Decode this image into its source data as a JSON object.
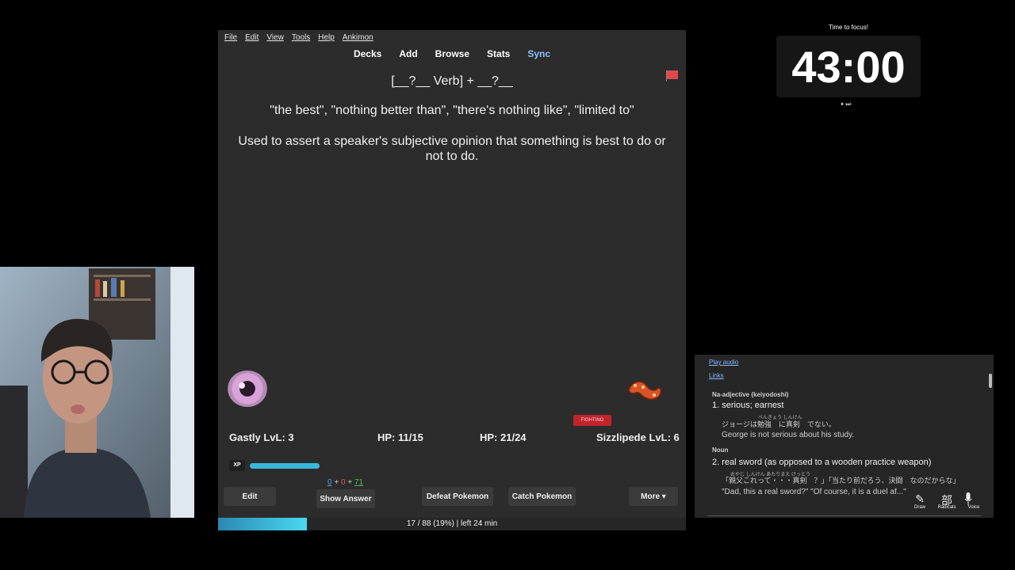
{
  "menu": [
    "File",
    "Edit",
    "View",
    "Tools",
    "Help",
    "Ankimon"
  ],
  "toolbar": {
    "decks": "Decks",
    "add": "Add",
    "browse": "Browse",
    "stats": "Stats",
    "sync": "Sync"
  },
  "card": {
    "front": "[__?__ Verb] + __?__",
    "meaning": "\"the best\", \"nothing better than\", \"there's nothing like\", \"limited to\"",
    "description": "Used to assert a speaker's subjective opinion that something is best to do or not to do."
  },
  "battle": {
    "type_badge": "FIGHTING",
    "player_level": "Gastly LvL: 3",
    "player_hp": "HP: 11/15",
    "enemy_hp": "HP: 21/24",
    "enemy_level": "Sizzlipede LvL: 6",
    "xp_label": "XP",
    "xp_fraction": 0.55
  },
  "counts": {
    "new": "0",
    "plus1": " + ",
    "learn": "0",
    "plus2": " + ",
    "review": "71"
  },
  "buttons": {
    "edit": "Edit",
    "show_answer": "Show Answer",
    "defeat": "Defeat Pokemon",
    "catch": "Catch Pokemon",
    "more": "More ▾"
  },
  "progress": {
    "text": "17 / 88 (19%) | left 24 min",
    "fraction": 0.19
  },
  "timer": {
    "label": "Time to focus!",
    "value": "43:00",
    "controls": "⏸ ⏭"
  },
  "dictionary": {
    "play_audio": "Play audio",
    "links": "Links",
    "pos1": "Na-adjective (keiyodoshi)",
    "def1": "1.  serious; earnest",
    "ex1_ruby": "べんきょう        しんけん",
    "ex1_jp": "ジョージは勉強　に真剣　でない。",
    "ex1_en": "George is not serious about his study.",
    "pos2": "Noun",
    "def2": "2.  real sword (as opposed to a wooden practice weapon)",
    "ex2_ruby": "おやじ                             しんけん          あたりまえ                けっとう",
    "ex2_jp": "「親父これって・・・真剣　？」「当たり前だろう、決闘　なのだからな」",
    "ex2_en": "\"Dad, this a real sword?\" \"Of course, it is a duel af...\"",
    "tools": {
      "draw": "Draw",
      "radicals": "Radicals",
      "voice": "Voice",
      "radicals_glyph": "部"
    }
  },
  "colors": {
    "flag": "#e0484f",
    "sync": "#8cc2ff",
    "xp_bar": "#39b8de",
    "review_count": "#46c24a",
    "learn_count": "#f0545a",
    "new_count": "#4aa6ff"
  }
}
